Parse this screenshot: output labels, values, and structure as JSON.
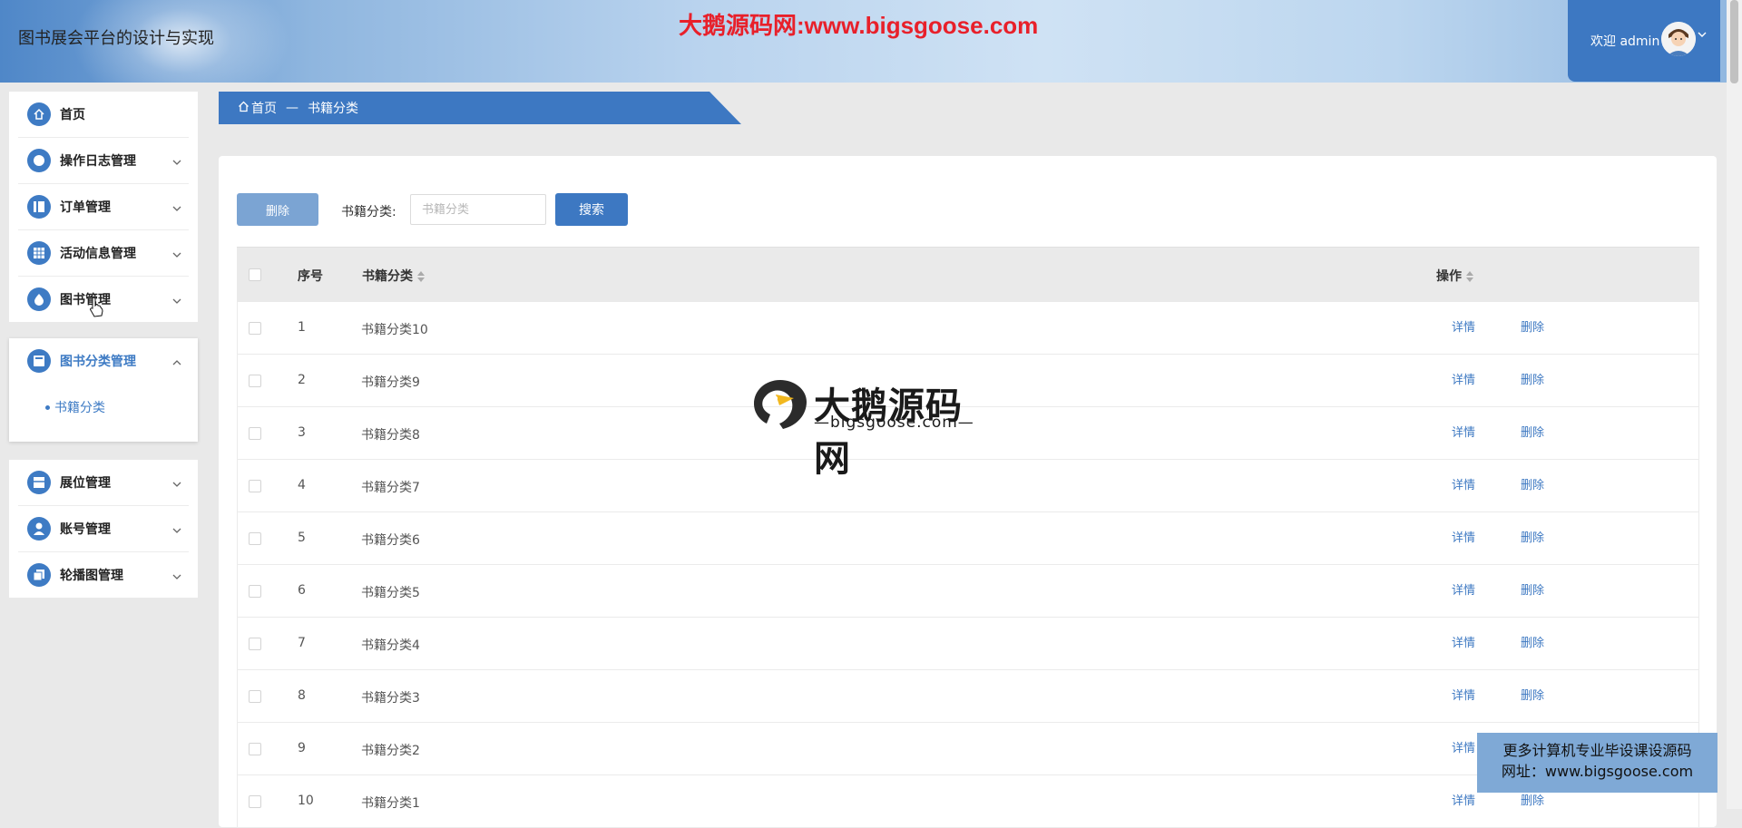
{
  "header": {
    "app_title": "图书展会平台的设计与实现",
    "watermark_top": "大鹅源码网:www.bigsgoose.com",
    "welcome": "欢迎 admin"
  },
  "sidebar": {
    "items": [
      {
        "label": "首页",
        "icon": "home-icon"
      },
      {
        "label": "操作日志管理",
        "icon": "circle-icon"
      },
      {
        "label": "订单管理",
        "icon": "order-icon"
      },
      {
        "label": "活动信息管理",
        "icon": "grid-icon"
      },
      {
        "label": "图书管理",
        "icon": "drop-icon"
      },
      {
        "label": "图书分类管理",
        "icon": "category-icon"
      },
      {
        "label": "展位管理",
        "icon": "booth-icon"
      },
      {
        "label": "账号管理",
        "icon": "user-icon"
      },
      {
        "label": "轮播图管理",
        "icon": "carousel-icon"
      }
    ],
    "sub_items": [
      {
        "label": "书籍分类"
      }
    ]
  },
  "breadcrumb": {
    "home": "首页",
    "separator": "—",
    "current": "书籍分类"
  },
  "toolbar": {
    "delete_label": "删除",
    "search_label": "书籍分类:",
    "search_placeholder": "书籍分类",
    "search_button": "搜索"
  },
  "table": {
    "headers": {
      "index": "序号",
      "category": "书籍分类",
      "action": "操作"
    },
    "rows": [
      {
        "index": "1",
        "category": "书籍分类10"
      },
      {
        "index": "2",
        "category": "书籍分类9"
      },
      {
        "index": "3",
        "category": "书籍分类8"
      },
      {
        "index": "4",
        "category": "书籍分类7"
      },
      {
        "index": "5",
        "category": "书籍分类6"
      },
      {
        "index": "6",
        "category": "书籍分类5"
      },
      {
        "index": "7",
        "category": "书籍分类4"
      },
      {
        "index": "8",
        "category": "书籍分类3"
      },
      {
        "index": "9",
        "category": "书籍分类2"
      },
      {
        "index": "10",
        "category": "书籍分类1"
      }
    ],
    "detail_label": "详情",
    "delete_label": "删除"
  },
  "watermark": {
    "big": "大鹅源码网",
    "small": "—bigsgoose.com—"
  },
  "promo": {
    "line1": "更多计算机专业毕设课设源码",
    "line2": "网址：www.bigsgoose.com"
  },
  "colors": {
    "primary": "#3d78c2",
    "primary_light": "#7ba4d3",
    "watermark_red": "#e8202a"
  }
}
